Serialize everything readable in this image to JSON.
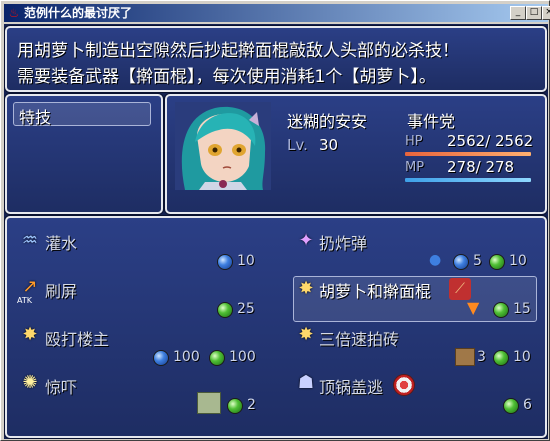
{
  "window": {
    "title": "范例什么的最讨厌了",
    "minimize_glyph": "_",
    "maximize_glyph": "□",
    "close_glyph": "×"
  },
  "help": {
    "line1": "用胡萝卜制造出空隙然后抄起擀面棍敲敌人头部的必杀技！",
    "line2": "需要装备武器【擀面棍】，每次使用消耗1个【胡萝卜】。"
  },
  "category": {
    "label": "特技"
  },
  "actor": {
    "name": "迷糊的安安",
    "class": "事件党",
    "level_label": "Lv.",
    "level": "30",
    "hp_label": "HP",
    "hp_value": "2562/ 2562",
    "hp_ratio": 1.0,
    "mp_label": "MP",
    "mp_value": "278/  278",
    "mp_ratio": 1.0,
    "colors": {
      "hp": "#e8643c",
      "mp": "#3ea0e8"
    }
  },
  "skills": [
    {
      "name": "灌水",
      "icon": "water-icon",
      "costs": [
        {
          "type": "blue",
          "value": "10"
        }
      ]
    },
    {
      "name": "扔炸弹",
      "icon": "bomb-sparkle-icon",
      "costs": [
        {
          "type": "blue",
          "value": "5"
        },
        {
          "type": "green",
          "value": "10"
        }
      ]
    },
    {
      "name": "刷屏",
      "icon": "atk-arrow-icon",
      "icon_text": "ATK",
      "costs": [
        {
          "type": "green",
          "value": "25"
        }
      ]
    },
    {
      "name": "胡萝卜和擀面棍",
      "icon": "burst-icon",
      "costs": [
        {
          "type": "green",
          "value": "15"
        }
      ],
      "selected": true
    },
    {
      "name": "殴打楼主",
      "icon": "burst-icon",
      "costs": [
        {
          "type": "blue",
          "value": "100"
        },
        {
          "type": "green",
          "value": "100"
        }
      ]
    },
    {
      "name": "三倍速拍砖",
      "icon": "burst-icon",
      "costs": [
        {
          "type": "green",
          "value": "10"
        }
      ]
    },
    {
      "name": "惊吓",
      "icon": "star-burst-icon",
      "costs": [
        {
          "type": "green",
          "value": "2"
        }
      ]
    },
    {
      "name": "顶锅盖逃",
      "icon": "crowd-icon",
      "costs": [
        {
          "type": "green",
          "value": "6"
        }
      ]
    }
  ],
  "item_costs": {
    "brick_count": "3"
  }
}
